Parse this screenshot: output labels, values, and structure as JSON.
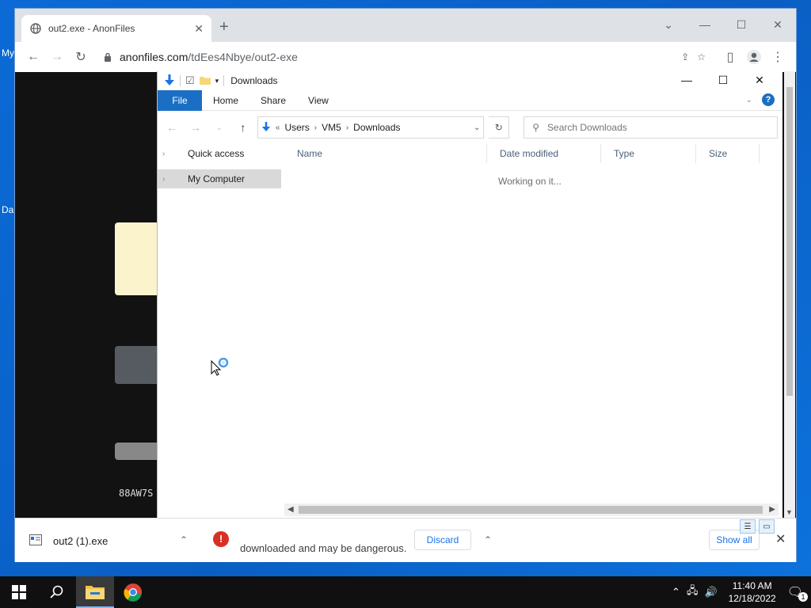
{
  "desktop": {
    "frag_top": "My",
    "frag_bottom": "Da"
  },
  "browser": {
    "tab_title": "out2.exe - AnonFiles",
    "url_host": "anonfiles.com",
    "url_path": "/tdEes4Nbye/out2-exe",
    "page_snippet": "88AW7S"
  },
  "explorer": {
    "title": "Downloads",
    "ribbon_tabs": [
      "File",
      "Home",
      "Share",
      "View"
    ],
    "breadcrumb": [
      "Users",
      "VM5",
      "Downloads"
    ],
    "breadcrumb_prefix": "«",
    "search_placeholder": "Search Downloads",
    "nav_items": [
      "Quick access",
      "My Computer"
    ],
    "columns": [
      "Name",
      "Date modified",
      "Type",
      "Size"
    ],
    "status": "Working on it..."
  },
  "shelf": {
    "file_name": "out2 (1).exe",
    "warning_text": "downloaded and may be dangerous.",
    "discard_label": "Discard",
    "show_all_label": "Show all"
  },
  "taskbar": {
    "time": "11:40 AM",
    "date": "12/18/2022",
    "notification_count": "1"
  }
}
